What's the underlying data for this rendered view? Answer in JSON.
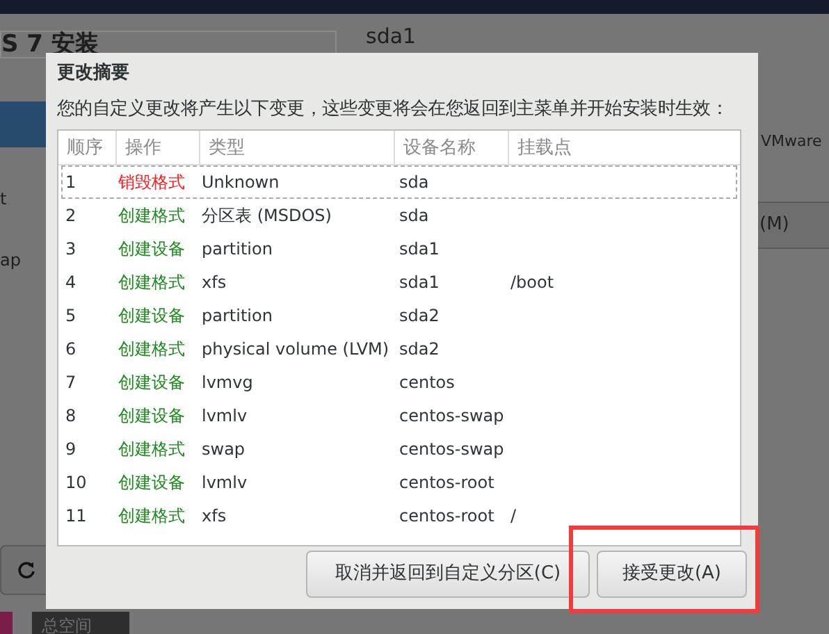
{
  "background": {
    "window_title": "S 7 安装",
    "device_title": "sda1",
    "side_item_1": "t",
    "side_item_2": "ap",
    "vendor": "VMware",
    "modify_button": "(M)",
    "total_space_label": "总空间"
  },
  "dialog": {
    "title": "更改摘要",
    "description": "您的自定义更改将产生以下变更，这些变更将会在您返回到主菜单并开始安装时生效：",
    "columns": [
      "顺序",
      "操作",
      "类型",
      "设备名称",
      "挂载点"
    ],
    "rows": [
      {
        "order": "1",
        "action": "销毁格式",
        "kind": "destroy",
        "type": "Unknown",
        "device": "sda",
        "focused": true
      },
      {
        "order": "2",
        "action": "创建格式",
        "kind": "create",
        "type": "分区表 (MSDOS)",
        "device": "sda",
        "focused": false
      },
      {
        "order": "3",
        "action": "创建设备",
        "kind": "create",
        "type": "partition",
        "device": "sda1",
        "focused": false
      },
      {
        "order": "4",
        "action": "创建格式",
        "kind": "create",
        "type": "xfs",
        "device": "sda1",
        "mount": "/boot",
        "focused": false
      },
      {
        "order": "5",
        "action": "创建设备",
        "kind": "create",
        "type": "partition",
        "device": "sda2",
        "focused": false
      },
      {
        "order": "6",
        "action": "创建格式",
        "kind": "create",
        "type": "physical volume (LVM)",
        "device": "sda2",
        "focused": false
      },
      {
        "order": "7",
        "action": "创建设备",
        "kind": "create",
        "type": "lvmvg",
        "device": "centos",
        "focused": false
      },
      {
        "order": "8",
        "action": "创建设备",
        "kind": "create",
        "type": "lvmlv",
        "device": "centos-swap",
        "focused": false
      },
      {
        "order": "9",
        "action": "创建格式",
        "kind": "create",
        "type": "swap",
        "device": "centos-swap",
        "focused": false
      },
      {
        "order": "10",
        "action": "创建设备",
        "kind": "create",
        "type": "lvmlv",
        "device": "centos-root",
        "focused": false
      },
      {
        "order": "11",
        "action": "创建格式",
        "kind": "create",
        "type": "xfs",
        "device": "centos-root",
        "mount": "/",
        "focused": false
      }
    ],
    "buttons": [
      "取消并返回到自定义分区(C)",
      "接受更改(A)"
    ]
  }
}
